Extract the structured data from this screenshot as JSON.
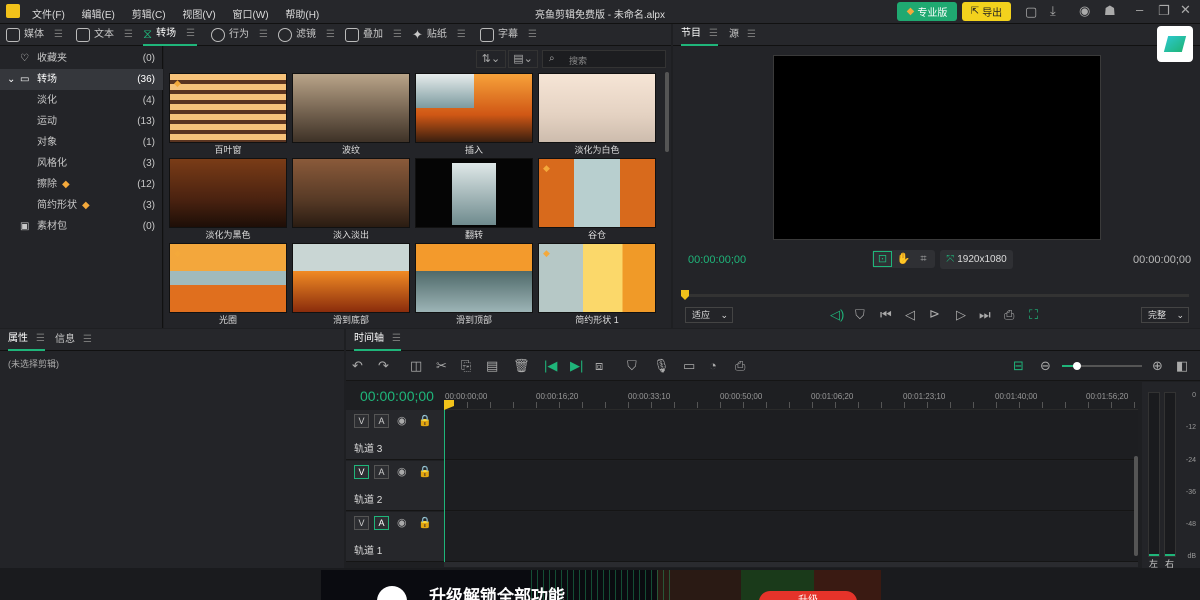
{
  "app": {
    "title": "亮鱼剪辑免费版 - 未命名.alpx"
  },
  "menu": [
    "文件(F)",
    "编辑(E)",
    "剪辑(C)",
    "视图(V)",
    "窗口(W)",
    "帮助(H)"
  ],
  "topbar": {
    "pro_label": "专业版",
    "export_label": "导出"
  },
  "library_tabs": [
    "媒体",
    "文本",
    "转场",
    "行为",
    "滤镜",
    "叠加",
    "贴纸",
    "字幕"
  ],
  "search": {
    "placeholder": "搜索"
  },
  "categories": [
    {
      "label": "收藏夹",
      "count": "(0)"
    },
    {
      "label": "转场",
      "count": "(36)"
    },
    {
      "label": "淡化",
      "count": "(4)"
    },
    {
      "label": "运动",
      "count": "(13)"
    },
    {
      "label": "对象",
      "count": "(1)"
    },
    {
      "label": "风格化",
      "count": "(3)"
    },
    {
      "label": "擦除",
      "count": "(12)"
    },
    {
      "label": "简约形状",
      "count": "(3)"
    },
    {
      "label": "素材包",
      "count": "(0)"
    }
  ],
  "thumbs": [
    "百叶窗",
    "波纹",
    "插入",
    "淡化为白色",
    "淡化为黑色",
    "淡入淡出",
    "翻转",
    "谷仓",
    "光圈",
    "滑到底部",
    "滑到顶部",
    "简约形状 1"
  ],
  "preview_tabs": [
    "节目",
    "源"
  ],
  "preview": {
    "time_left": "00:00:00;00",
    "time_right": "00:00:00;00",
    "resolution": "1920x1080",
    "fit": "适应",
    "quality": "完整"
  },
  "props_tabs": [
    "属性",
    "信息"
  ],
  "props": {
    "empty": "(未选择剪辑)"
  },
  "timeline": {
    "tab": "时间轴",
    "timecode": "00:00:00;00",
    "ruler": [
      "00:00:00;00",
      "00:00:16;20",
      "00:00:33;10",
      "00:00:50;00",
      "00:01:06;20",
      "00:01:23;10",
      "00:01:40;00",
      "00:01:56;20"
    ],
    "tracks": [
      "轨道 3",
      "轨道 2",
      "轨道 1"
    ]
  },
  "meter": {
    "db": [
      "0",
      "-12",
      "-24",
      "-36",
      "-48",
      "dB"
    ],
    "left": "左",
    "right": "右"
  },
  "banner": {
    "text": "升级解锁全部功能",
    "button": "升级"
  }
}
